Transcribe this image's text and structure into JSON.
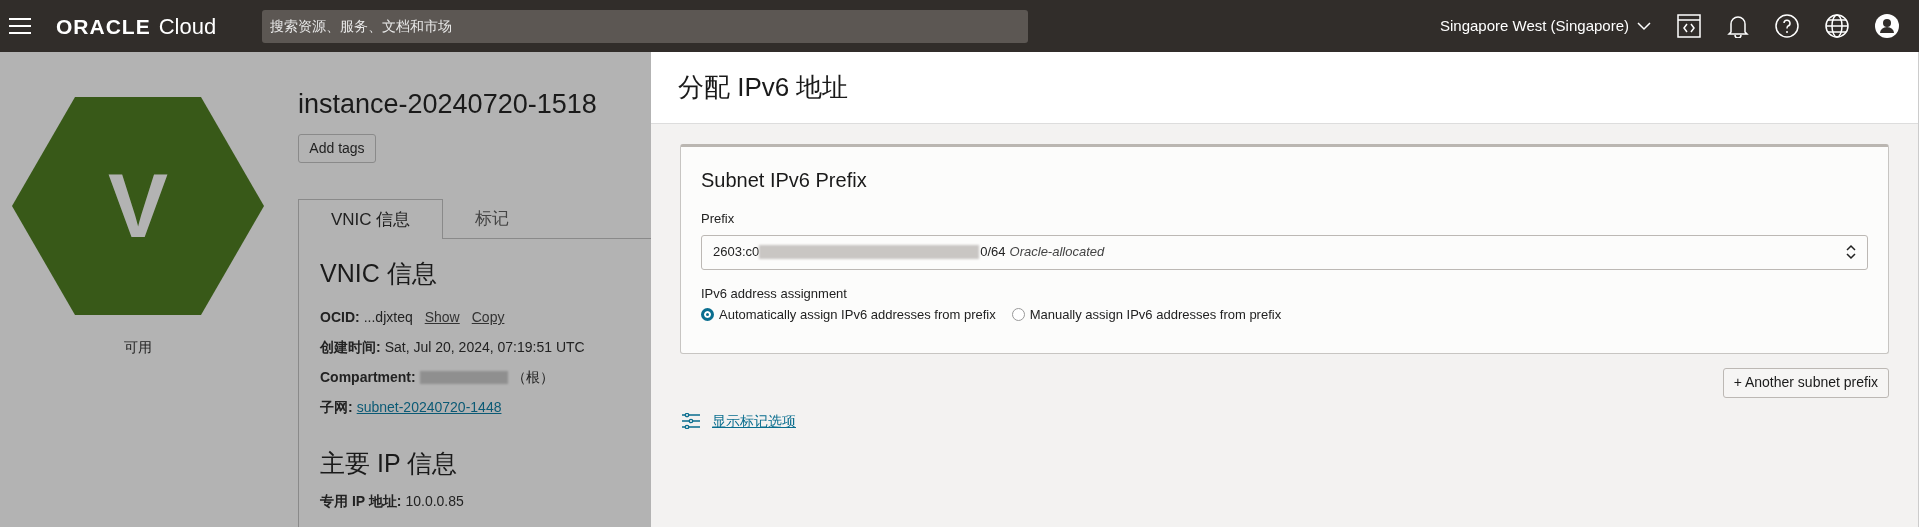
{
  "header": {
    "brand": "ORACLE",
    "product": "Cloud",
    "search": {
      "placeholder": "搜索资源、服务、文档和市场"
    },
    "region": "Singapore West (Singapore)"
  },
  "instance": {
    "letter": "V",
    "status": "可用",
    "title": "instance-20240720-1518",
    "add_tags": "Add tags",
    "tabs": [
      {
        "label": "VNIC 信息",
        "selected": true
      },
      {
        "label": "标记",
        "selected": false
      }
    ],
    "section_title": "VNIC 信息",
    "ocid": {
      "label": "OCID:",
      "value": "...djxteq",
      "links": [
        "Show",
        "Copy"
      ]
    },
    "created": {
      "label": "创建时间:",
      "value": "Sat, Jul 20, 2024, 07:19:51 UTC"
    },
    "compartment": {
      "label": "Compartment:",
      "suffix": "（根）"
    },
    "subnet": {
      "label": "子网:",
      "value": "subnet-20240720-1448"
    },
    "ip_title": "主要 IP 信息",
    "private_ip": {
      "label": "专用 IP 地址:",
      "value": "10.0.0.85"
    }
  },
  "panel": {
    "title": "分配 IPv6 地址",
    "card_title": "Subnet IPv6 Prefix",
    "prefix_label": "Prefix",
    "prefix_start": "2603:c0",
    "prefix_end": "0/64",
    "prefix_note": "Oracle-allocated",
    "assignment_label": "IPv6 address assignment",
    "options": [
      {
        "label": "Automatically assign IPv6 addresses from prefix",
        "selected": true
      },
      {
        "label": "Manually assign IPv6 addresses from prefix",
        "selected": false
      }
    ],
    "another_button": "+ Another subnet prefix",
    "tags_link": "显示标记选项"
  }
}
